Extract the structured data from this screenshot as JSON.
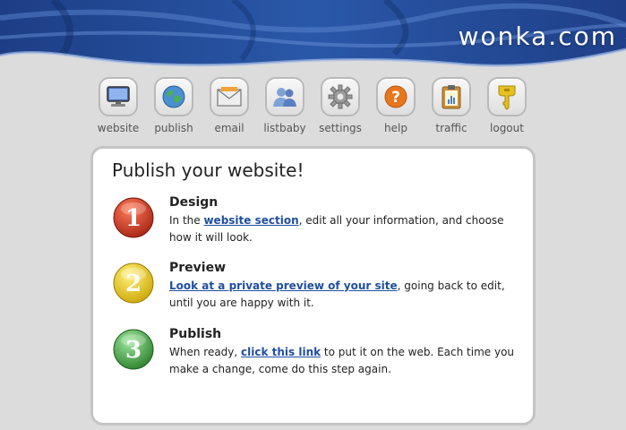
{
  "header": {
    "brand": "wonka.com",
    "colors": {
      "banner_dark": "#16346e",
      "banner_light": "#4f79c4"
    }
  },
  "nav": {
    "items": [
      {
        "label": "website",
        "icon": "monitor-icon"
      },
      {
        "label": "publish",
        "icon": "globe-icon"
      },
      {
        "label": "email",
        "icon": "envelope-icon"
      },
      {
        "label": "listbaby",
        "icon": "people-icon"
      },
      {
        "label": "settings",
        "icon": "gear-icon"
      },
      {
        "label": "help",
        "icon": "question-icon"
      },
      {
        "label": "traffic",
        "icon": "clipboard-icon"
      },
      {
        "label": "logout",
        "icon": "key-icon"
      }
    ]
  },
  "main": {
    "title": "Publish your website!",
    "steps": [
      {
        "number": "1",
        "color": "#cc3222",
        "title": "Design",
        "pre": "In the ",
        "link": "website section",
        "post": ", edit all your information, and choose how it will look."
      },
      {
        "number": "2",
        "color": "#f0d21a",
        "title": "Preview",
        "pre": "",
        "link": "Look at a private preview of your site",
        "post": ", going back to edit, until you are happy with it."
      },
      {
        "number": "3",
        "color": "#3da43d",
        "title": "Publish",
        "pre": "When ready, ",
        "link": "click this link",
        "post": " to put it on the web. Each time you make a change, come do this step again."
      }
    ]
  }
}
